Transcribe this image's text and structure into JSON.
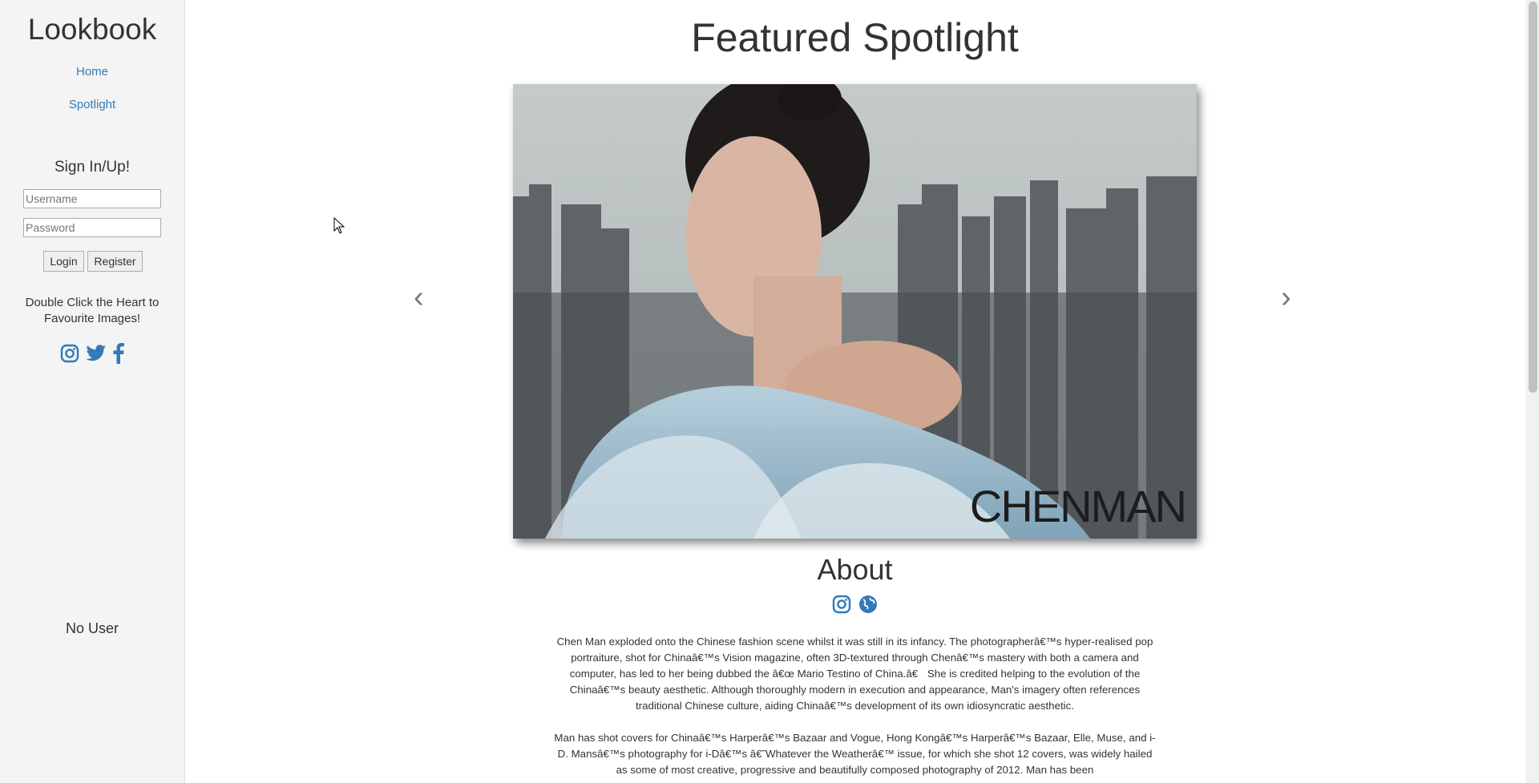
{
  "sidebar": {
    "brand": "Lookbook",
    "nav": [
      {
        "label": "Home"
      },
      {
        "label": "Spotlight"
      }
    ],
    "signin_title": "Sign In/Up!",
    "username_placeholder": "Username",
    "password_placeholder": "Password",
    "login_label": "Login",
    "register_label": "Register",
    "hint": "Double Click the Heart to Favourite Images!",
    "social_icons": [
      "instagram-icon",
      "twitter-icon",
      "facebook-icon"
    ],
    "user_status": "No User"
  },
  "main": {
    "title": "Featured Spotlight",
    "prev_glyph": "‹",
    "next_glyph": "›",
    "photo_caption": "CHENMAN",
    "about_title": "About",
    "about_icons": [
      "instagram-icon",
      "globe-icon"
    ],
    "paragraphs": [
      "Chen Man exploded onto the Chinese fashion scene whilst it was still in its infancy. The photographerâ€™s hyper-realised pop portraiture, shot for Chinaâ€™s Vision magazine, often 3D-textured through Chenâ€™s mastery with both a camera and computer, has led to her being dubbed the â€œ Mario Testino of China.â€ She is credited helping to the evolution of the Chinaâ€™s beauty aesthetic. Although thoroughly modern in execution and appearance, Man's imagery often references traditional Chinese culture, aiding Chinaâ€™s development of its own idiosyncratic aesthetic.",
      "Man has shot covers for Chinaâ€™s Harperâ€™s Bazaar and Vogue, Hong Kongâ€™s Harperâ€™s Bazaar, Elle, Muse, and i-D. Mansâ€™s photography for i-Dâ€™s â€˜Whatever the Weatherâ€™ issue, for which she shot 12 covers, was widely hailed as some of most creative, progressive and beautifully composed photography of 2012. Man has been"
    ]
  },
  "colors": {
    "link": "#337ab7",
    "sidebar_bg": "#f4f4f4",
    "text": "#333333"
  }
}
